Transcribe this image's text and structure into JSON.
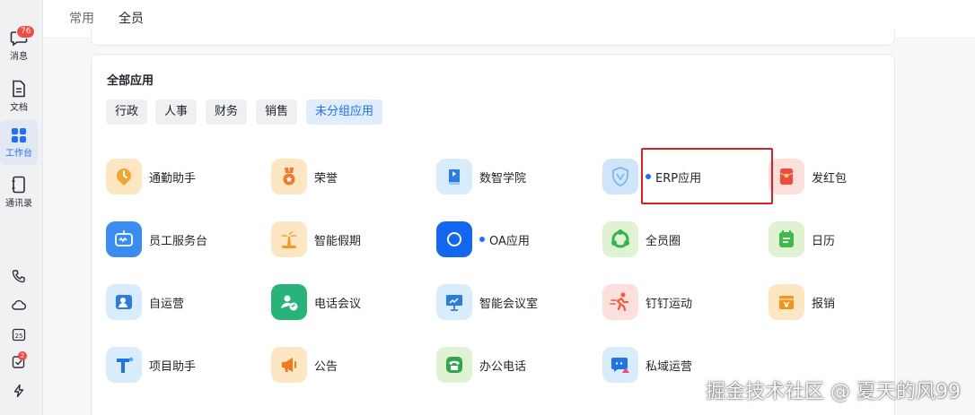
{
  "rail": {
    "messages": {
      "label": "消息",
      "badge": "76",
      "icon": "chat-bubble-icon"
    },
    "docs": {
      "label": "文档",
      "icon": "document-icon"
    },
    "workbench": {
      "label": "工作台",
      "icon": "grid-icon"
    },
    "contacts": {
      "label": "通讯录",
      "icon": "contacts-book-icon"
    },
    "tools": [
      {
        "name": "phone-icon"
      },
      {
        "name": "cloud-icon"
      },
      {
        "name": "calendar-icon",
        "text": "25"
      },
      {
        "name": "todo-icon",
        "badge": "2"
      },
      {
        "name": "lightning-icon"
      }
    ]
  },
  "tabs": [
    {
      "label": "常用",
      "active": false
    },
    {
      "label": "全员",
      "active": true
    }
  ],
  "card": {
    "title": "全部应用",
    "chips": [
      {
        "label": "行政",
        "active": false
      },
      {
        "label": "人事",
        "active": false
      },
      {
        "label": "财务",
        "active": false
      },
      {
        "label": "销售",
        "active": false
      },
      {
        "label": "未分组应用",
        "active": true
      }
    ],
    "apps": [
      {
        "label": "通勤助手",
        "icon": "clock-pin-icon",
        "bg": "#fde7c3",
        "fg": "#f2a431",
        "dot": false
      },
      {
        "label": "荣誉",
        "icon": "medal-icon",
        "bg": "#fde7c3",
        "fg": "#f07a2f",
        "dot": false
      },
      {
        "label": "数智学院",
        "icon": "book-icon",
        "bg": "#d8ecfb",
        "fg": "#2b7de3",
        "dot": false
      },
      {
        "label": "ERP应用",
        "icon": "erp-shield-icon",
        "bg": "#cfe5fa",
        "fg": "#7fb6ee",
        "dot": true
      },
      {
        "label": "发红包",
        "icon": "red-envelope-icon",
        "bg": "#fde0dc",
        "fg": "#ef4a3c",
        "dot": false
      },
      {
        "label": "员工服务台",
        "icon": "robot-icon",
        "bg": "#3b8cf0",
        "fg": "#ffffff",
        "dot": false
      },
      {
        "label": "智能假期",
        "icon": "palm-tree-icon",
        "bg": "#fde7c3",
        "fg": "#f29a1f",
        "dot": false
      },
      {
        "label": "OA应用",
        "icon": "circle-icon",
        "bg": "#1167f0",
        "fg": "#ffffff",
        "dot": true
      },
      {
        "label": "全员圈",
        "icon": "people-circle-icon",
        "bg": "#dff3d2",
        "fg": "#36b34a",
        "dot": false
      },
      {
        "label": "日历",
        "icon": "calendar-icon",
        "bg": "#dff3d2",
        "fg": "#3fb948",
        "dot": false
      },
      {
        "label": "自运营",
        "icon": "person-card-icon",
        "bg": "#d8ecfb",
        "fg": "#2a7ce0",
        "dot": false
      },
      {
        "label": "电话会议",
        "icon": "phone-person-icon",
        "bg": "#27b37a",
        "fg": "#ffffff",
        "dot": false
      },
      {
        "label": "智能会议室",
        "icon": "presentation-icon",
        "bg": "#d8ecfb",
        "fg": "#2a7ce0",
        "dot": false
      },
      {
        "label": "钉钉运动",
        "icon": "runner-icon",
        "bg": "#fde0dc",
        "fg": "#ef5a3c",
        "dot": false
      },
      {
        "label": "报销",
        "icon": "receipt-icon",
        "bg": "#fde7c3",
        "fg": "#f2961f",
        "dot": false
      },
      {
        "label": "项目助手",
        "icon": "t-letter-icon",
        "bg": "#d8ecfb",
        "fg": "#1f74e6",
        "dot": false
      },
      {
        "label": "公告",
        "icon": "megaphone-icon",
        "bg": "#fde7c3",
        "fg": "#f27a1f",
        "dot": false
      },
      {
        "label": "办公电话",
        "icon": "telephone-icon",
        "bg": "#dff3d2",
        "fg": "#2ea84a",
        "dot": false
      },
      {
        "label": "私域运营",
        "icon": "chat-triangle-icon",
        "bg": "#d8ecfb",
        "fg": "#1f74e6",
        "dot": false
      }
    ]
  },
  "watermark": "掘金技术社区 @ 夏天的风99"
}
